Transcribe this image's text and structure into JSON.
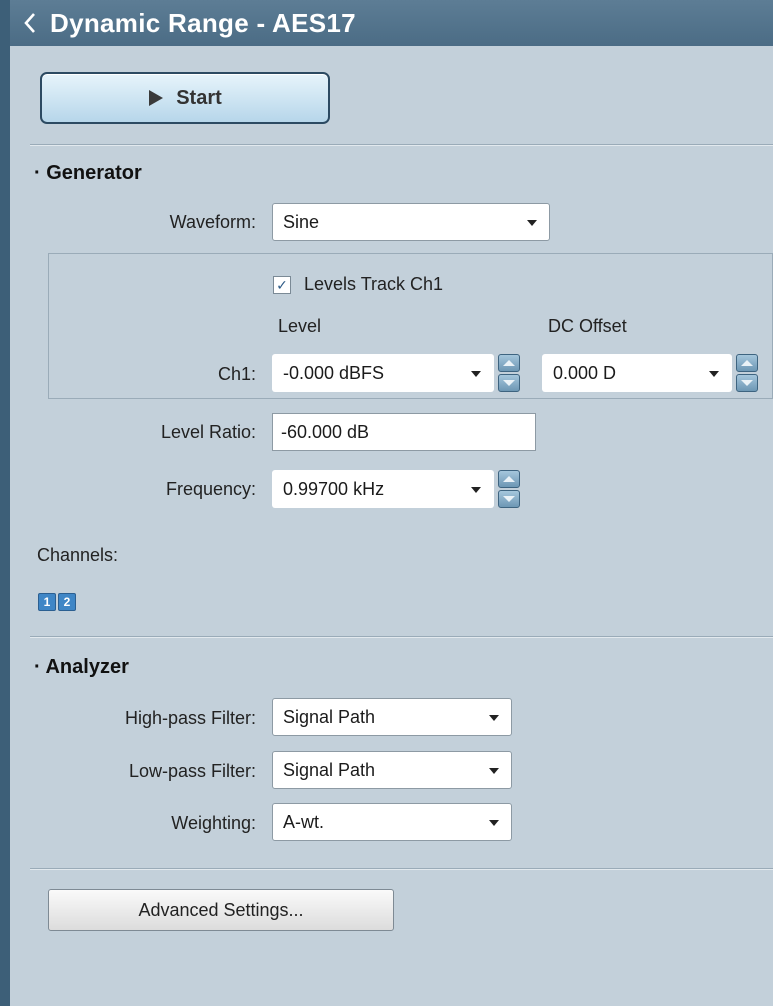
{
  "header": {
    "title": "Dynamic Range - AES17"
  },
  "toolbar": {
    "start_label": "Start"
  },
  "generator": {
    "title": "Generator",
    "waveform": {
      "label": "Waveform:",
      "value": "Sine"
    },
    "levels_track": {
      "label": "Levels Track Ch1",
      "checked": true,
      "check_glyph": "✓"
    },
    "columns": {
      "level": "Level",
      "dc_offset": "DC Offset"
    },
    "ch1": {
      "label": "Ch1:",
      "level_value": "-0.000 dBFS",
      "dc_offset_value": "0.000 D"
    },
    "level_ratio": {
      "label": "Level Ratio:",
      "value": "-60.000 dB"
    },
    "frequency": {
      "label": "Frequency:",
      "value": "0.99700 kHz"
    },
    "channels": {
      "label": "Channels:",
      "buttons": [
        "1",
        "2"
      ]
    }
  },
  "analyzer": {
    "title": "Analyzer",
    "high_pass": {
      "label": "High-pass Filter:",
      "value": "Signal Path"
    },
    "low_pass": {
      "label": "Low-pass Filter:",
      "value": "Signal Path"
    },
    "weighting": {
      "label": "Weighting:",
      "value": "A-wt."
    }
  },
  "footer": {
    "advanced_label": "Advanced Settings..."
  },
  "colors": {
    "panel": "#c3d0da",
    "titlebar": "#4b6c85",
    "accent": "#3f86c6"
  },
  "icons": [
    "back-chevron-icon",
    "play-icon",
    "dropdown-caret-icon",
    "spinner-icon"
  ]
}
